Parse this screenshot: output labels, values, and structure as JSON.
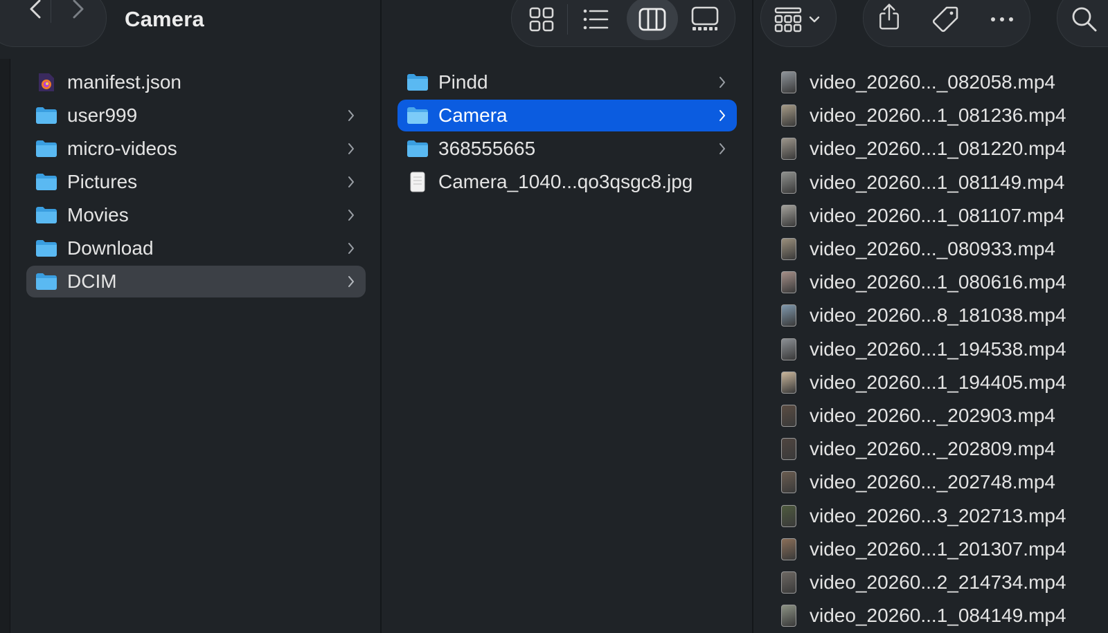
{
  "window": {
    "title": "Camera"
  },
  "toolbar": {
    "back_icon": "chevron-left-icon",
    "forward_icon": "chevron-right-icon",
    "views": [
      "icon-view-icon",
      "list-view-icon",
      "column-view-icon",
      "gallery-view-icon"
    ],
    "active_view": "column-view-icon",
    "group_icon": "group-by-icon",
    "actions": [
      "share-icon",
      "tag-icon",
      "more-icon"
    ],
    "search_icon": "search-icon"
  },
  "colors": {
    "background": "#1f2327",
    "selection_blue": "#0b5ce0",
    "selection_gray": "#3c4046",
    "folder_blue": "#55b7f0"
  },
  "column1": {
    "items": [
      {
        "label": "manifest.json",
        "kind": "json-file"
      },
      {
        "label": "user999",
        "kind": "folder"
      },
      {
        "label": "micro-videos",
        "kind": "folder"
      },
      {
        "label": "Pictures",
        "kind": "folder"
      },
      {
        "label": "Movies",
        "kind": "folder"
      },
      {
        "label": "Download",
        "kind": "folder"
      },
      {
        "label": "DCIM",
        "kind": "folder",
        "selected": "inactive"
      }
    ]
  },
  "column2": {
    "items": [
      {
        "label": "Pindd",
        "kind": "folder"
      },
      {
        "label": "Camera",
        "kind": "folder",
        "selected": "active"
      },
      {
        "label": "368555665",
        "kind": "folder"
      },
      {
        "label": "Camera_1040...qo3qsgc8.jpg",
        "kind": "image-file"
      }
    ]
  },
  "column3": {
    "items": [
      {
        "label": "video_20260..._082058.mp4",
        "thumb": "#8e949a"
      },
      {
        "label": "video_20260...1_081236.mp4",
        "thumb": "#a59a86"
      },
      {
        "label": "video_20260...1_081220.mp4",
        "thumb": "#9c958b"
      },
      {
        "label": "video_20260...1_081149.mp4",
        "thumb": "#8f918e"
      },
      {
        "label": "video_20260...1_081107.mp4",
        "thumb": "#a3a19b"
      },
      {
        "label": "video_20260..._080933.mp4",
        "thumb": "#9a8f7c"
      },
      {
        "label": "video_20260...1_080616.mp4",
        "thumb": "#a58f88"
      },
      {
        "label": "video_20260...8_181038.mp4",
        "thumb": "#7f98ad"
      },
      {
        "label": "video_20260...1_194538.mp4",
        "thumb": "#8b8f94"
      },
      {
        "label": "video_20260...1_194405.mp4",
        "thumb": "#c9b69b"
      },
      {
        "label": "video_20260..._202903.mp4",
        "thumb": "#5a4c42"
      },
      {
        "label": "video_20260..._202809.mp4",
        "thumb": "#4f4540"
      },
      {
        "label": "video_20260..._202748.mp4",
        "thumb": "#6a5c50"
      },
      {
        "label": "video_20260...3_202713.mp4",
        "thumb": "#4e5a3e"
      },
      {
        "label": "video_20260...1_201307.mp4",
        "thumb": "#8a6e58"
      },
      {
        "label": "video_20260...2_214734.mp4",
        "thumb": "#6d6863"
      },
      {
        "label": "video_20260...1_084149.mp4",
        "thumb": "#8c9284"
      }
    ]
  }
}
